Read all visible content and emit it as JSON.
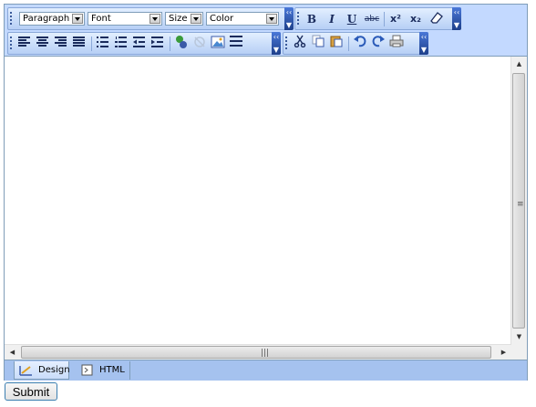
{
  "toolbar": {
    "format_combo": {
      "value": "Paragraph"
    },
    "font_combo": {
      "value": "Font"
    },
    "size_combo": {
      "value": "Size"
    },
    "color_combo": {
      "value": "Color"
    },
    "text_buttons": {
      "bold": "B",
      "italic": "I",
      "underline": "U",
      "strike": "abc",
      "superscript": "x²",
      "subscript": "x₂"
    },
    "align_icons": [
      "align-left-icon",
      "align-center-icon",
      "align-right-icon",
      "align-justify-icon"
    ],
    "list_icons": [
      "bullet-list-icon",
      "numbered-list-icon",
      "outdent-icon",
      "indent-icon"
    ],
    "insert_icons": [
      "link-icon",
      "unlink-icon",
      "image-icon",
      "horizontal-rule-icon"
    ],
    "edit_icons": [
      "cut-icon",
      "copy-icon",
      "paste-icon",
      "undo-icon",
      "redo-icon",
      "print-icon"
    ]
  },
  "modes": {
    "design": "Design",
    "html": "HTML"
  },
  "submit": {
    "label": "Submit"
  },
  "colors": {
    "toolbar_bg": "#c3d9ff",
    "mode_bar_bg": "#a5c2ef",
    "icon_color": "#1a2b5c",
    "submit_border": "#3c7fb1"
  }
}
